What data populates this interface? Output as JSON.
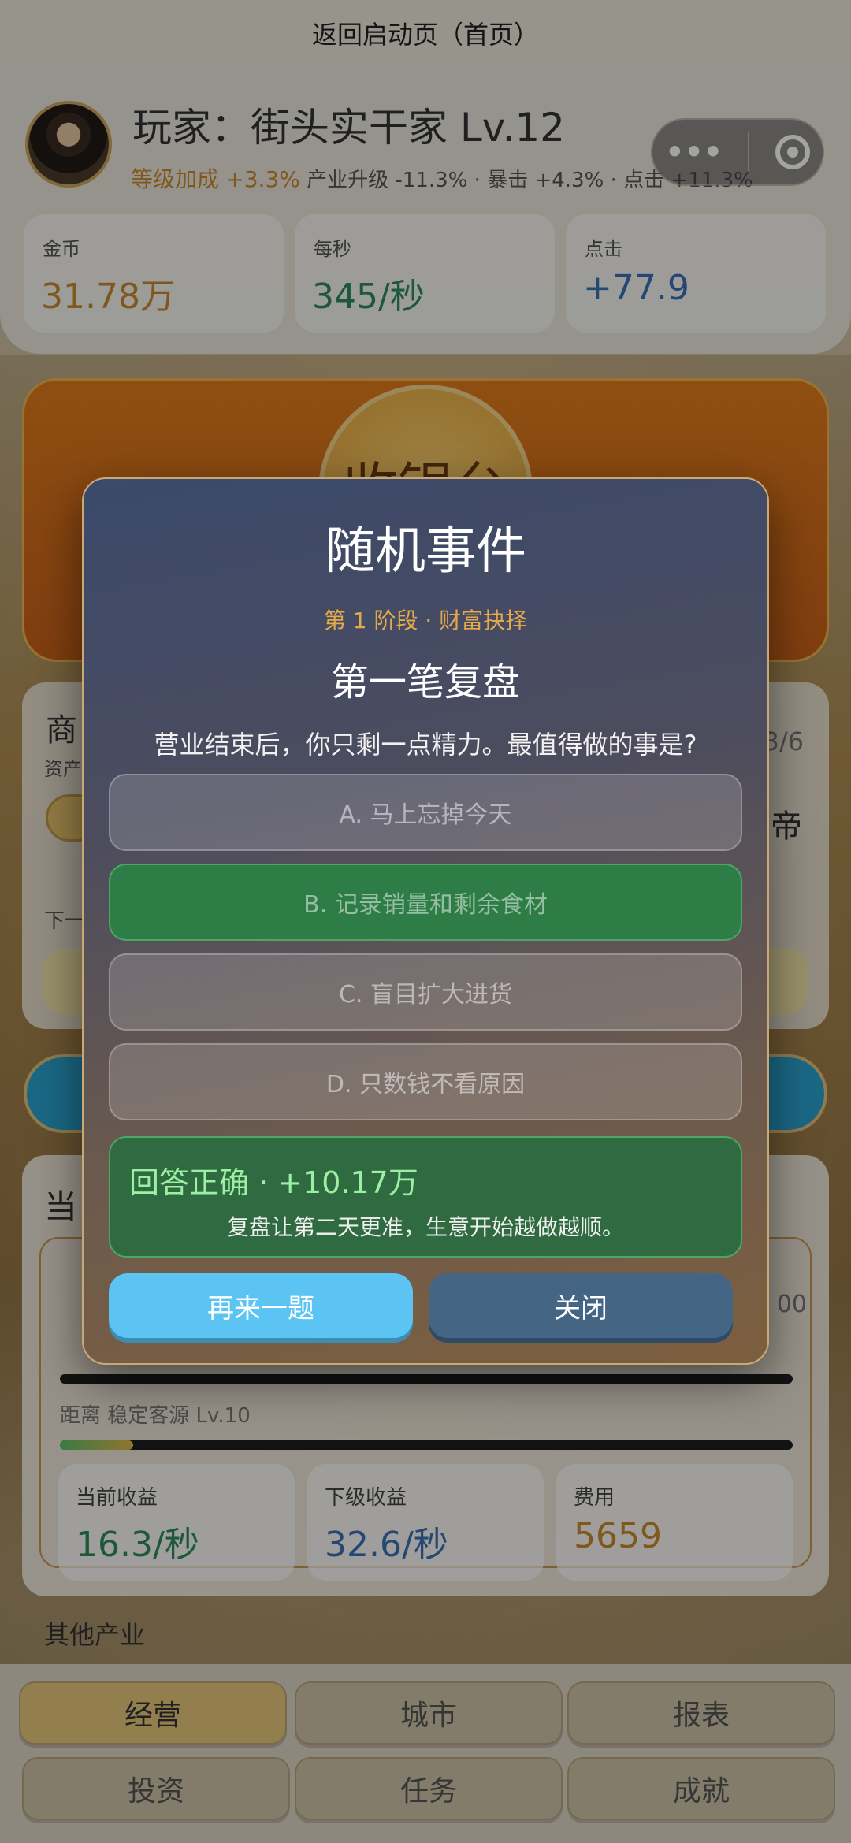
{
  "nav": {
    "back_label": "返回启动页（首页）"
  },
  "player": {
    "name": "玩家：街头实干家 Lv.12",
    "bonus_label": "等级加成",
    "bonus_value": "+3.3%",
    "stats_line": "产业升级 -11.3% · 暴击 +4.3% · 点击 +11.3%"
  },
  "stats": [
    {
      "label": "金币",
      "value": "31.78万",
      "color": "#c9892e"
    },
    {
      "label": "每秒",
      "value": "345/秒",
      "color": "#2d8a5a"
    },
    {
      "label": "点击",
      "value": "+77.9",
      "color": "#3a6fb5"
    }
  ],
  "stage": {
    "coin_label": "收银台"
  },
  "panel": {
    "title_char": "商",
    "asset_char": "资产",
    "right_frac": "3/6",
    "right_char": "帝",
    "next_char": "下一",
    "section_char": "当",
    "distance_label": "距离 稳定客源 Lv.10",
    "right_num": "00"
  },
  "income": [
    {
      "label": "当前收益",
      "value": "16.3/秒",
      "color": "#2d8a5a"
    },
    {
      "label": "下级收益",
      "value": "32.6/秒",
      "color": "#3a6fb5"
    },
    {
      "label": "费用",
      "value": "5659",
      "color": "#c9892e"
    }
  ],
  "other_label": "其他产业",
  "tabs": [
    {
      "label": "经营",
      "active": true
    },
    {
      "label": "城市"
    },
    {
      "label": "报表"
    },
    {
      "label": "投资"
    },
    {
      "label": "任务"
    },
    {
      "label": "成就"
    }
  ],
  "event": {
    "title": "随机事件",
    "stage_line": "第 1 阶段 · 财富抉择",
    "question_title": "第一笔复盘",
    "prompt": "营业结束后，你只剩一点精力。最值得做的事是?",
    "options": [
      {
        "label": "A. 马上忘掉今天",
        "correct": false
      },
      {
        "label": "B. 记录销量和剩余食材",
        "correct": true
      },
      {
        "label": "C. 盲目扩大进货",
        "correct": false
      },
      {
        "label": "D. 只数钱不看原因",
        "correct": false
      }
    ],
    "result_title": "回答正确 · +10.17万",
    "result_desc": "复盘让第二天更准，生意开始越做越顺。",
    "again_label": "再来一题",
    "close_label": "关闭"
  }
}
